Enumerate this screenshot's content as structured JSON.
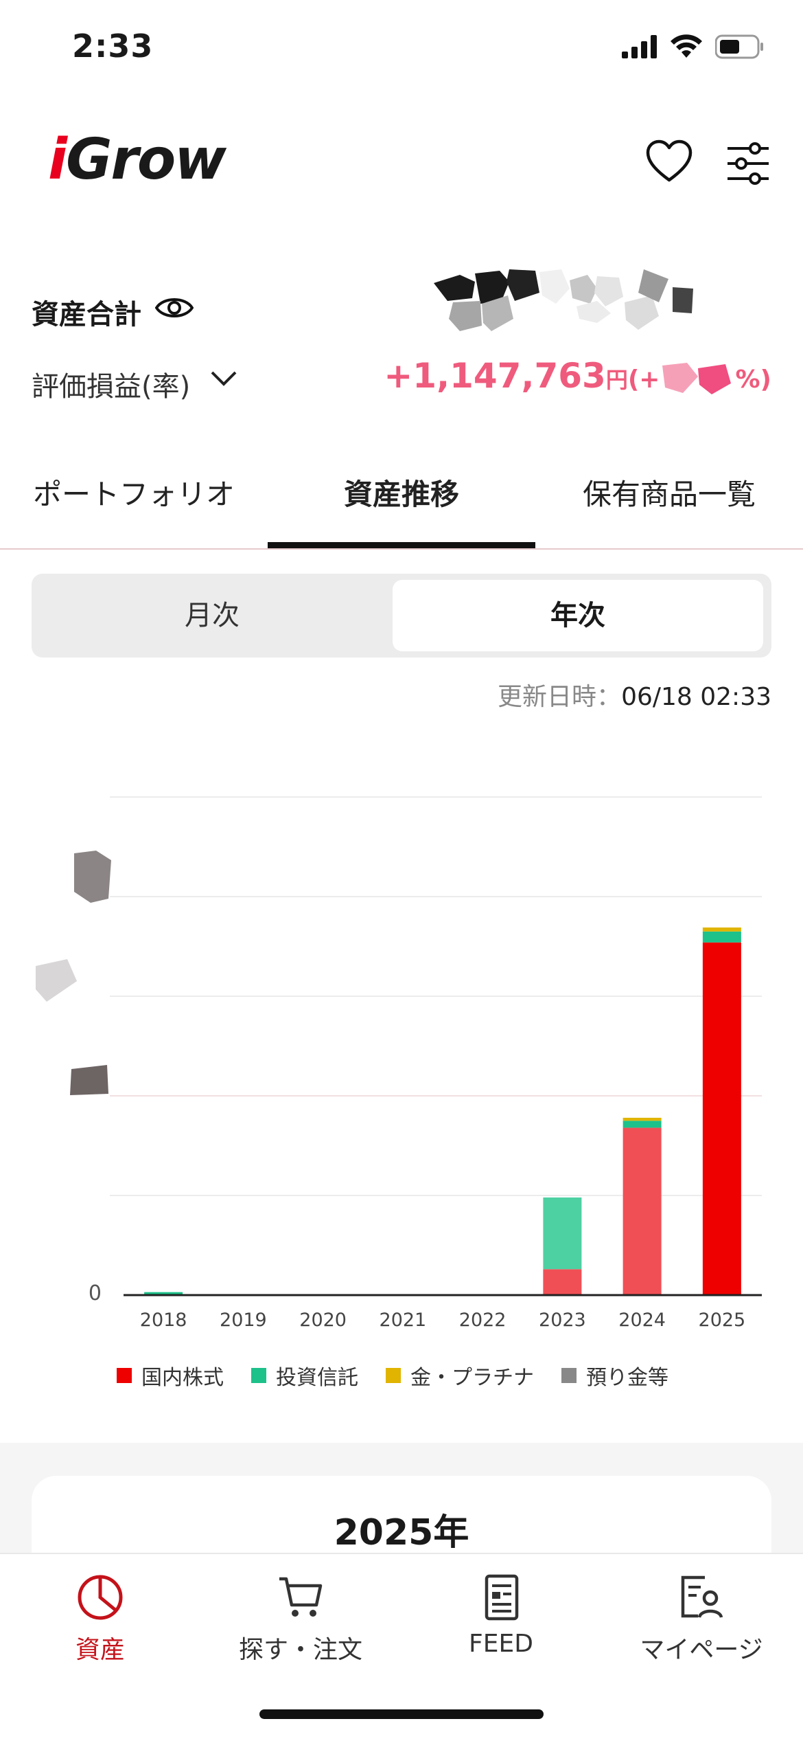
{
  "status_bar": {
    "time": "2:33"
  },
  "header": {
    "logo": "iGrow",
    "heart_icon": "heart-icon",
    "filter_icon": "sliders-icon"
  },
  "summary": {
    "asset_total_label": "資産合計",
    "pl_label": "評価損益(率)",
    "pl_value": "+1,147,763",
    "pl_yen": "円",
    "pl_rate": "(+",
    "pl_rate_tail": "%)"
  },
  "tabs": {
    "portfolio": "ポートフォリオ",
    "asset_history": "資産推移",
    "holdings": "保有商品一覧"
  },
  "segment": {
    "monthly": "月次",
    "yearly": "年次"
  },
  "update": {
    "label": "更新日時：",
    "value": "06/18 02:33"
  },
  "chart_data": {
    "type": "bar",
    "stacked": true,
    "categories": [
      "2018",
      "2019",
      "2020",
      "2021",
      "2022",
      "2023",
      "2024",
      "2025"
    ],
    "y_tick_label": "0",
    "ylim": [
      0,
      5
    ],
    "grid": true,
    "series": [
      {
        "name": "国内株式",
        "color": "#ee0000",
        "values": [
          0,
          0,
          0,
          0,
          0,
          0.26,
          1.68,
          3.54
        ]
      },
      {
        "name": "投資信託",
        "color": "#1dc18a",
        "values": [
          0.03,
          0,
          0,
          0,
          0,
          0.72,
          0.07,
          0.11
        ]
      },
      {
        "name": "金・プラチナ",
        "color": "#e0b400",
        "values": [
          0,
          0,
          0,
          0,
          0,
          0,
          0.03,
          0.04
        ]
      },
      {
        "name": "預り金等",
        "color": "#888888",
        "values": [
          0,
          0,
          0,
          0,
          0,
          0,
          0,
          0
        ]
      }
    ]
  },
  "section": {
    "year_title": "2025年"
  },
  "nav": {
    "asset": "資産",
    "search": "探す・注文",
    "feed": "FEED",
    "mypage": "マイページ"
  }
}
